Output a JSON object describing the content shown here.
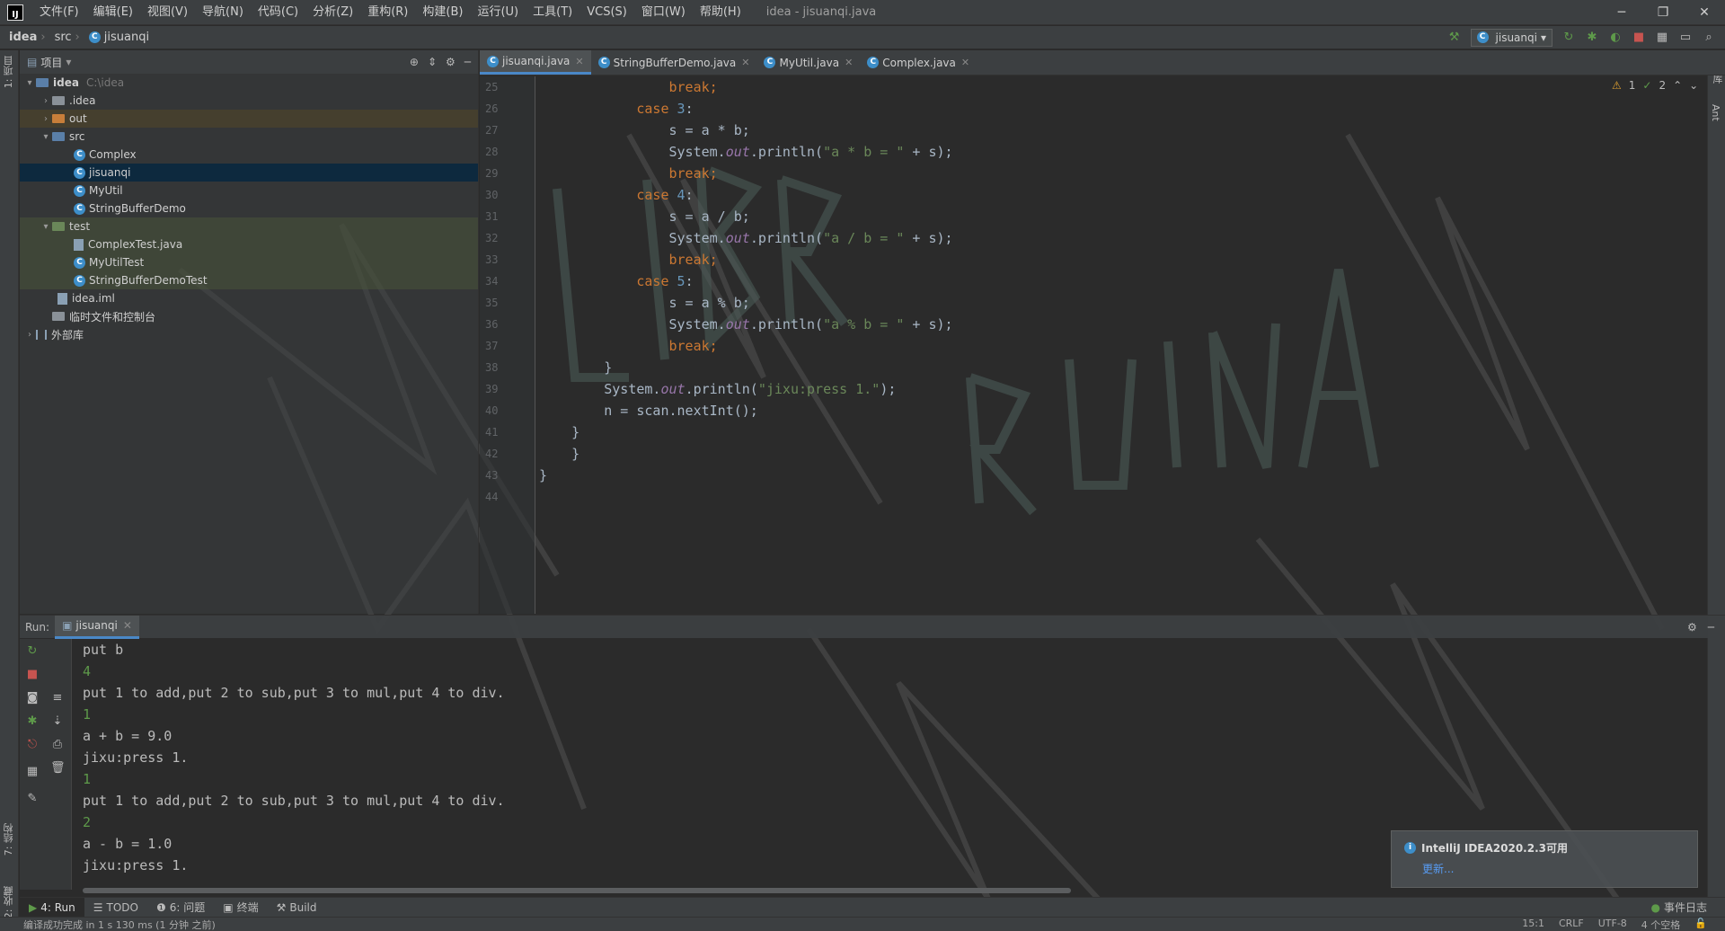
{
  "menubar": {
    "logo": "IJ",
    "items": [
      "文件(F)",
      "编辑(E)",
      "视图(V)",
      "导航(N)",
      "代码(C)",
      "分析(Z)",
      "重构(R)",
      "构建(B)",
      "运行(U)",
      "工具(T)",
      "VCS(S)",
      "窗口(W)",
      "帮助(H)"
    ],
    "window_title": "idea - jisuanqi.java"
  },
  "navbar": {
    "crumbs": [
      "idea",
      "src",
      "jisuanqi"
    ],
    "run_config": "jisuanqi"
  },
  "left_strip": {
    "project_tab": "1: 项目",
    "structure_tab": "7: 结构",
    "favorites_tab": "2: 收藏"
  },
  "right_strip": {
    "ant_tab": "Ant",
    "db_tab": "数据库"
  },
  "project": {
    "title": "项目",
    "root": {
      "name": "idea",
      "path": "C:\\idea"
    },
    "items": {
      "idea_dir": ".idea",
      "out": "out",
      "src": "src",
      "complex": "Complex",
      "jisuanqi": "jisuanqi",
      "myutil": "MyUtil",
      "sbdemo": "StringBufferDemo",
      "test": "test",
      "complextest": "ComplexTest.java",
      "myutiltest": "MyUtilTest",
      "sbdemotest": "StringBufferDemoTest",
      "iml": "idea.iml",
      "scratches": "临时文件和控制台",
      "extlib": "外部库"
    }
  },
  "editor": {
    "tabs": [
      "jisuanqi.java",
      "StringBufferDemo.java",
      "MyUtil.java",
      "Complex.java"
    ],
    "line_numbers": [
      "25",
      "26",
      "27",
      "28",
      "29",
      "30",
      "31",
      "32",
      "33",
      "34",
      "35",
      "36",
      "37",
      "38",
      "39",
      "40",
      "41",
      "42",
      "43",
      "44"
    ],
    "warnings": "1",
    "weak_warnings": "2",
    "code": {
      "break": "break;",
      "case": "case",
      "n3": "3",
      "n4": "4",
      "n5": "5",
      "colon": ":",
      "s_eq_mul": "s = a * b;",
      "s_eq_div": "s = a / b;",
      "s_eq_mod": "s = a % b;",
      "sys": "System.",
      "out": "out",
      "println_open": ".println(",
      "str_mul": "\"a * b = \"",
      "str_div": "\"a / b = \"",
      "str_mod": "\"a % b = \"",
      "plus_s": " + s);",
      "close_brace": "}",
      "str_jixu": "\"jixu:press 1.\"",
      "paren_close": ");",
      "n_scan": "n = scan.nextInt();"
    }
  },
  "run": {
    "label": "Run:",
    "tab": "jisuanqi",
    "console": [
      {
        "text": "put b",
        "input": false
      },
      {
        "text": "4",
        "input": true
      },
      {
        "text": "put 1 to add,put 2 to sub,put 3 to mul,put 4 to div.",
        "input": false
      },
      {
        "text": "1",
        "input": true
      },
      {
        "text": "a + b = 9.0",
        "input": false
      },
      {
        "text": "jixu:press 1.",
        "input": false
      },
      {
        "text": "1",
        "input": true
      },
      {
        "text": "put 1 to add,put 2 to sub,put 3 to mul,put 4 to div.",
        "input": false
      },
      {
        "text": "2",
        "input": true
      },
      {
        "text": "a - b = 1.0",
        "input": false
      },
      {
        "text": "jixu:press 1.",
        "input": false
      }
    ]
  },
  "notification": {
    "title": "IntelliJ IDEA2020.2.3可用",
    "link": "更新..."
  },
  "bottom_tabs": {
    "run": "4: Run",
    "todo": "TODO",
    "problems": "6: 问题",
    "terminal": "终端",
    "build": "Build",
    "event_log": "事件日志"
  },
  "status": {
    "message": "编译成功完成 in 1 s 130 ms (1 分钟 之前)",
    "position": "15:1",
    "line_sep": "CRLF",
    "encoding": "UTF-8",
    "indent": "4 个空格"
  },
  "colors": {
    "keyword": "#cc7832",
    "number": "#6897bb",
    "string": "#6a8759",
    "field": "#9876aa",
    "accent": "#4a88c7"
  }
}
